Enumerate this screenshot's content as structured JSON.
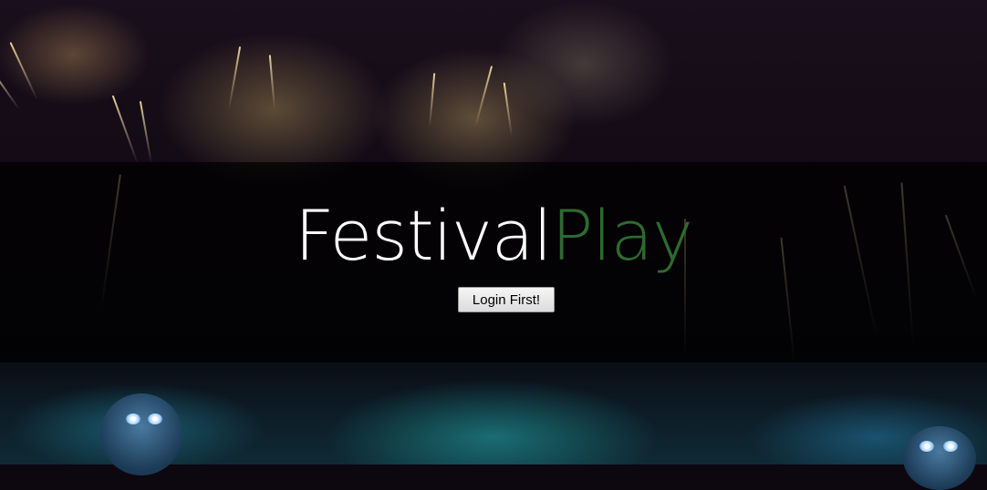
{
  "hero": {
    "title_part1": "Festival",
    "title_part2": "Play",
    "login_button_label": "Login First!"
  },
  "colors": {
    "title_white": "#ffffff",
    "title_green": "#2d6a2f",
    "overlay": "rgba(0,0,0,0.72)"
  }
}
